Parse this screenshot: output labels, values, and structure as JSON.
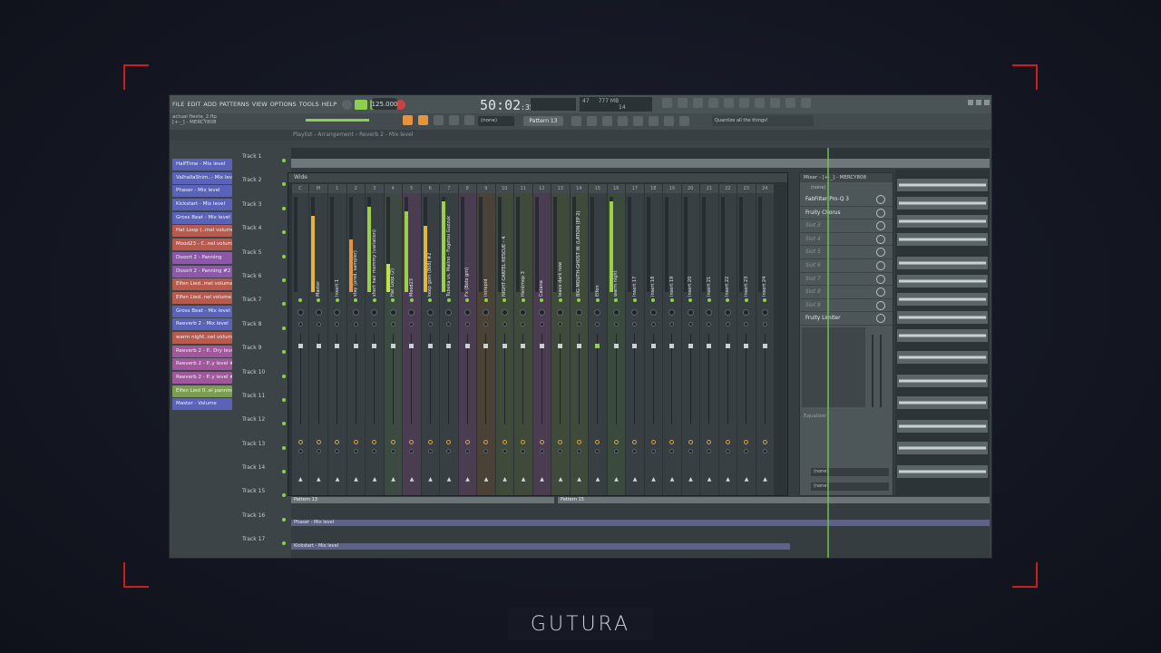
{
  "menu": [
    "FILE",
    "EDIT",
    "ADD",
    "PATTERNS",
    "VIEW",
    "OPTIONS",
    "TOOLS",
    "HELP"
  ],
  "transport": {
    "tempo": "125.000",
    "time": "50:02",
    "time_sub": ":35",
    "pattern": "Pattern 13",
    "snap": "(none)",
    "cpu": "47",
    "mem": "777 MB",
    "voices": "14"
  },
  "project": {
    "file": "actual fiesta_2.flp",
    "line2": "[+-_] - MERCY808"
  },
  "hint": "Quantize all the things!",
  "playlist_title": "Playlist - Arrangement › Reverb 2 - Mix level",
  "clips": [
    {
      "label": "HalfTime - Mix level",
      "color": "#5a63b8"
    },
    {
      "label": "ValhallaShim..- Mix level",
      "color": "#5a63b8"
    },
    {
      "label": "Phaser - Mix level",
      "color": "#5a63b8"
    },
    {
      "label": "Kickstart - Mix level",
      "color": "#5a63b8"
    },
    {
      "label": "Gross Beat - Mix level",
      "color": "#5a63b8"
    },
    {
      "label": "Hat Loop (..mel volume",
      "color": "#b85a4e"
    },
    {
      "label": "Mood23 - C..nel volume",
      "color": "#b85a4e"
    },
    {
      "label": "Dssort 2 - Panning",
      "color": "#8e58a8"
    },
    {
      "label": "Dssort 2 - Panning #2",
      "color": "#8e58a8"
    },
    {
      "label": "Elfen Lied..mel volume",
      "color": "#b85a4e"
    },
    {
      "label": "Elfen Lied..nel volume",
      "color": "#b85a4e"
    },
    {
      "label": "Gross Beat - Mix level",
      "color": "#5a63b8"
    },
    {
      "label": "Reeverb 2 - Mix level",
      "color": "#5a63b8"
    },
    {
      "label": "warm night..nel volume",
      "color": "#b85a4e"
    },
    {
      "label": "Reeverb 2 - P.. Dry level",
      "color": "#a0579c"
    },
    {
      "label": "Reeverb 2 - P..y level #2",
      "color": "#a0579c"
    },
    {
      "label": "Reeverb 2 - P..y level #3",
      "color": "#a0579c"
    },
    {
      "label": "Elfen Lied 0..el panning",
      "color": "#7b9e4e"
    },
    {
      "label": "Master - Volume",
      "color": "#5a63b8"
    }
  ],
  "tracks": [
    "Track 1",
    "Track 2",
    "Track 3",
    "Track 4",
    "Track 5",
    "Track 6",
    "Track 7",
    "Track 8",
    "Track 9",
    "Track 10",
    "Track 11",
    "Track 12",
    "Track 13",
    "Track 14",
    "Track 15",
    "Track 16",
    "Track 17"
  ],
  "mixer": {
    "title": "Wide",
    "strips": [
      {
        "num": "C",
        "name": "",
        "color": "#383f42",
        "meter": 0.0,
        "meter_color": "#8bd14f"
      },
      {
        "num": "M",
        "name": "Master",
        "color": "#383f42",
        "meter": 0.8,
        "meter_color": "#e8b33a"
      },
      {
        "num": "1",
        "name": "Insert 1",
        "color": "#383f42",
        "meter": 0.0,
        "meter_color": "#e8b33a"
      },
      {
        "num": "2",
        "name": "stay (prod. sampler)",
        "color": "#383f42",
        "meter": 0.55,
        "meter_color": "#e8923a"
      },
      {
        "num": "3",
        "name": "short hair mommy (variation)",
        "color": "#383f42",
        "meter": 0.9,
        "meter_color": "#9ad244"
      },
      {
        "num": "4",
        "name": "Hat Loop (2)",
        "color": "#3d4a41",
        "meter": 0.3,
        "meter_color": "#c4e04a"
      },
      {
        "num": "5",
        "name": "Mood23",
        "color": "#4a3d52",
        "meter": 0.85,
        "meter_color": "#9ad244"
      },
      {
        "num": "6",
        "name": "keep goin (808) #2",
        "color": "#383f42",
        "meter": 0.7,
        "meter_color": "#e8b33a"
      },
      {
        "num": "7",
        "name": "Tubeka vs. Malino - Fugetsu Guzzuk",
        "color": "#383f42",
        "meter": 0.95,
        "meter_color": "#9ad244"
      },
      {
        "num": "8",
        "name": "Fx (Bots gm)",
        "color": "#4a3d52",
        "meter": 0.0,
        "meter_color": "#9ad244"
      },
      {
        "num": "9",
        "name": "Intrepid",
        "color": "#4b4237",
        "meter": 0.0,
        "meter_color": "#9ad244"
      },
      {
        "num": "10",
        "name": "NIGHT CARTEL RESCUE - 4",
        "color": "#3f4a3b",
        "meter": 0.0,
        "meter_color": "#9ad244"
      },
      {
        "num": "11",
        "name": "Hentmop 3",
        "color": "#3f4a3b",
        "meter": 0.0,
        "meter_color": "#9ad244"
      },
      {
        "num": "12",
        "name": "Catana",
        "color": "#4a3d52",
        "meter": 0.0,
        "meter_color": "#9ad244"
      },
      {
        "num": "13",
        "name": "leave dark now",
        "color": "#3f4a3b",
        "meter": 0.0,
        "meter_color": "#9ad244"
      },
      {
        "num": "14",
        "name": "BIG MOUTH-GHOST W. (LATION (EP 2)",
        "color": "#3f4a3b",
        "meter": 0.0,
        "meter_color": "#9ad244"
      },
      {
        "num": "15",
        "name": "Elfen",
        "color": "#383f42",
        "meter": 0.0,
        "meter_color": "#9ad244"
      },
      {
        "num": "16",
        "name": "warm night",
        "color": "#3a4a3c",
        "meter": 0.95,
        "meter_color": "#9ad244"
      },
      {
        "num": "17",
        "name": "Insert 17",
        "color": "#383f42",
        "meter": 0.0,
        "meter_color": "#9ad244"
      },
      {
        "num": "18",
        "name": "Insert 18",
        "color": "#383f42",
        "meter": 0.0,
        "meter_color": "#9ad244"
      },
      {
        "num": "19",
        "name": "Insert 19",
        "color": "#383f42",
        "meter": 0.0,
        "meter_color": "#9ad244"
      },
      {
        "num": "20",
        "name": "Insert 20",
        "color": "#383f42",
        "meter": 0.0,
        "meter_color": "#9ad244"
      },
      {
        "num": "21",
        "name": "Insert 21",
        "color": "#383f42",
        "meter": 0.0,
        "meter_color": "#9ad244"
      },
      {
        "num": "22",
        "name": "Insert 22",
        "color": "#383f42",
        "meter": 0.0,
        "meter_color": "#9ad244"
      },
      {
        "num": "23",
        "name": "Insert 23",
        "color": "#383f42",
        "meter": 0.0,
        "meter_color": "#9ad244"
      },
      {
        "num": "24",
        "name": "Insert 24",
        "color": "#383f42",
        "meter": 0.0,
        "meter_color": "#9ad244"
      }
    ]
  },
  "fx": {
    "title": "Mixer - [+-_] - MERCY808",
    "preset": "(none)",
    "slots": [
      {
        "label": "FabFilter Pro-Q 3",
        "active": true
      },
      {
        "label": "Fruity Chorus",
        "active": true
      },
      {
        "label": "Slot 3",
        "active": false
      },
      {
        "label": "Slot 4",
        "active": false
      },
      {
        "label": "Slot 5",
        "active": false
      },
      {
        "label": "Slot 6",
        "active": false
      },
      {
        "label": "Slot 7",
        "active": false
      },
      {
        "label": "Slot 8",
        "active": false
      },
      {
        "label": "Slot 9",
        "active": false
      },
      {
        "label": "Fruity Limiter",
        "active": true
      }
    ],
    "eq_label": "Equalizer",
    "send1": "(none)",
    "send2": "(none)"
  },
  "automation": {
    "pat1": "Pattern 13",
    "pat2": "Pattern 15",
    "lane1": "Phaser - Mix level",
    "lane2": "Kickstart - Mix level"
  },
  "brand": "GUTURA",
  "colors": {
    "accent": "#8bd14f",
    "frame": "#d01c1c",
    "bg": "#141722"
  }
}
